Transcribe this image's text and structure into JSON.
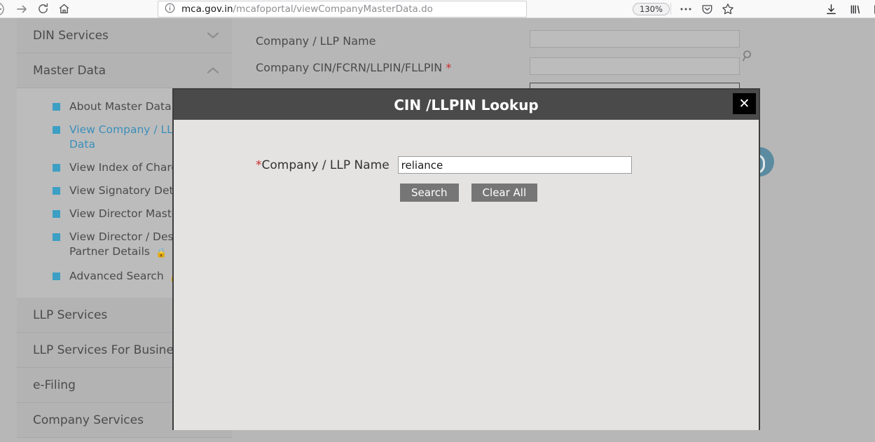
{
  "browser": {
    "back_icon": "back-arrow-icon",
    "forward_icon": "forward-arrow-icon",
    "reload_icon": "reload-icon",
    "home_icon": "home-icon",
    "info_icon": "page-info-icon",
    "url_host": "mca.gov.in",
    "url_path": "/mcafoportal/viewCompanyMasterData.do",
    "zoom_level": "130%",
    "menu_icon": "ellipsis-icon",
    "pocket_icon": "pocket-icon",
    "bookmark_icon": "star-icon",
    "downloads_icon": "download-arrow-icon",
    "library_icon": "library-icon",
    "sidebar_icon": "reader-view-icon"
  },
  "sidebar": {
    "sections": [
      {
        "label": "DIN Services",
        "chevron": "chevron-down-icon",
        "expanded": false
      },
      {
        "label": "Master Data",
        "chevron": "chevron-up-icon",
        "expanded": true
      }
    ],
    "master_data_items": [
      {
        "label": "About Master Data",
        "active": false,
        "locked": false
      },
      {
        "label": "View Company / LLP Master Data",
        "active": true,
        "locked": false
      },
      {
        "label": "View Index of Charges",
        "active": false,
        "locked": false
      },
      {
        "label": "View Signatory Details",
        "active": false,
        "locked": false
      },
      {
        "label": "View Director Master Details",
        "active": false,
        "locked": false
      },
      {
        "label": "View Director / Designated Partner Details",
        "active": false,
        "locked": true
      },
      {
        "label": "Advanced Search",
        "active": false,
        "locked": true
      }
    ],
    "bottom_sections": [
      {
        "label": "LLP Services"
      },
      {
        "label": "LLP Services For Business"
      },
      {
        "label": "e-Filing"
      },
      {
        "label": "Company Services"
      }
    ],
    "lock_glyph": "🔒",
    "bullet_color": "#3d9fc4"
  },
  "main_form": {
    "fields": [
      {
        "label": "Company / LLP Name",
        "required": false,
        "value": ""
      },
      {
        "label": "Company CIN/FCRN/LLPIN/FLLPIN",
        "required": true,
        "value": ""
      },
      {
        "label": "",
        "required": false,
        "value": ""
      }
    ],
    "search_icon": "magnifier-icon",
    "help_icon": "help-circle-icon"
  },
  "modal": {
    "title": "CIN /LLPIN Lookup",
    "close_label": "✕",
    "close_icon": "close-icon",
    "field_label": "Company / LLP Name",
    "field_required_marker": "*",
    "field_value": "reliance",
    "field_placeholder": "",
    "search_button": "Search",
    "clear_button": "Clear All",
    "header_color": "#4a4a4a",
    "body_color": "#e4e3e2"
  }
}
